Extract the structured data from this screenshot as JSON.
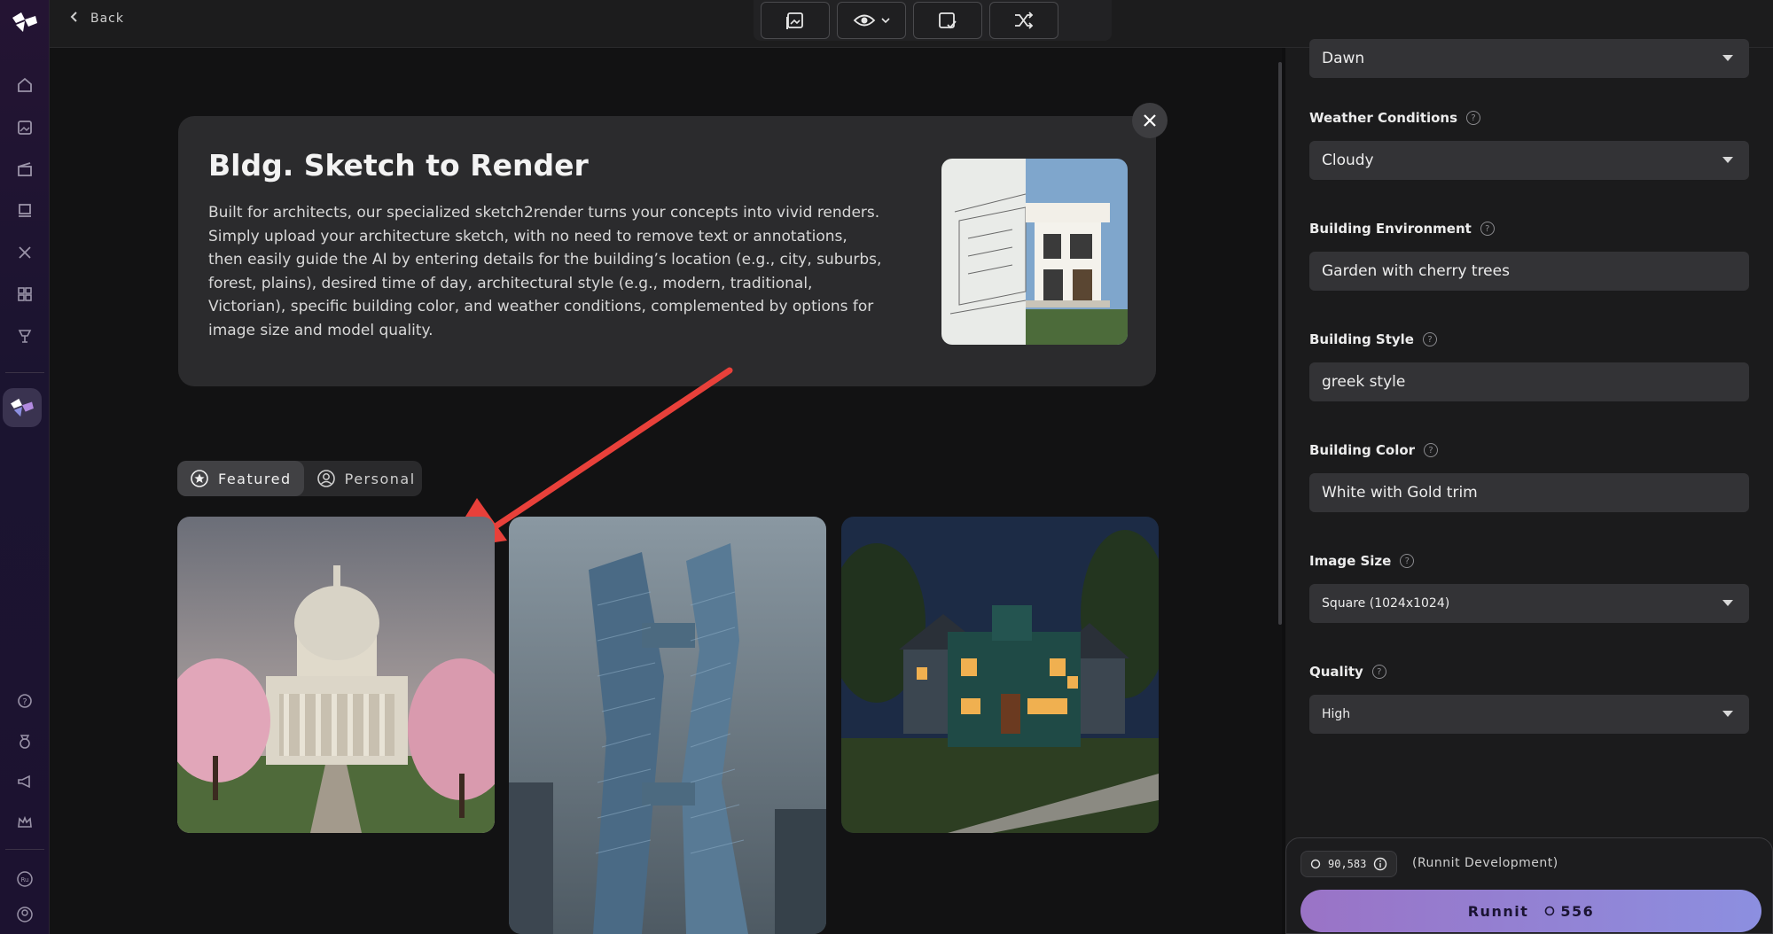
{
  "topbar": {
    "back_label": "Back",
    "tools": [
      "gallery-icon",
      "eye-dropdown-icon",
      "image-check-icon",
      "shuffle-icon"
    ]
  },
  "sidebar": {
    "icons": [
      "home-icon",
      "images-icon",
      "clapper-icon",
      "stack-icon",
      "tools-icon",
      "grid-icon",
      "trophy-icon",
      "logo-icon",
      "help-icon",
      "medal-icon",
      "megaphone-icon",
      "crown-icon",
      "ru-badge",
      "account-icon"
    ]
  },
  "info_card": {
    "title": "Bldg. Sketch to Render",
    "description": "Built for architects, our specialized sketch2render turns your concepts into vivid renders. Simply upload your architecture sketch, with no need to remove text or annotations, then easily guide the AI by entering details for the building’s location (e.g., city, suburbs, forest, plains), desired time of day, architectural style (e.g., modern, traditional, Victorian), specific building color, and weather conditions, complemented by options for image size and model quality."
  },
  "tabs": [
    {
      "label": "Featured",
      "active": true
    },
    {
      "label": "Personal",
      "active": false
    }
  ],
  "panel": {
    "time_of_day_value": "Dawn",
    "weather": {
      "label": "Weather Conditions",
      "value": "Cloudy"
    },
    "environment": {
      "label": "Building Environment",
      "value": "Garden with cherry trees"
    },
    "style": {
      "label": "Building Style",
      "value": "greek style"
    },
    "color": {
      "label": "Building Color",
      "value": "White with Gold trim"
    },
    "image_size": {
      "label": "Image Size",
      "value": "Square (1024x1024)"
    },
    "quality": {
      "label": "Quality",
      "value": "High"
    }
  },
  "run": {
    "credits": "90,583",
    "environment": "(Runnit Development)",
    "button_label": "Runnit",
    "cost": "556"
  },
  "colors": {
    "accent_start": "#9a73c6",
    "accent_end": "#8c8fe0",
    "annotation_arrow": "#e8403a"
  }
}
